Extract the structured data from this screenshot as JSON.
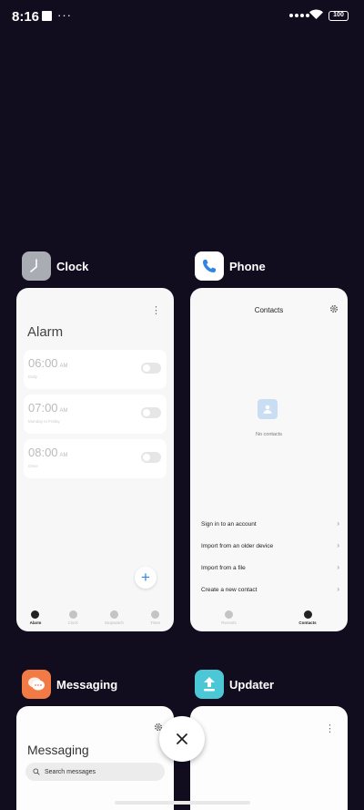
{
  "status": {
    "time": "8:16",
    "dots": "···",
    "battery": "100"
  },
  "apps": {
    "clock": {
      "name": "Clock",
      "title": "Alarm",
      "alarms": [
        {
          "time": "06:00",
          "ampm": "AM",
          "sub": "Daily"
        },
        {
          "time": "07:00",
          "ampm": "AM",
          "sub": "Monday to Friday"
        },
        {
          "time": "08:00",
          "ampm": "AM",
          "sub": "Once"
        }
      ],
      "tabs": [
        "Alarm",
        "Clock",
        "Stopwatch",
        "Timer"
      ],
      "fab": "+"
    },
    "phone": {
      "name": "Phone",
      "title": "Contacts",
      "empty": "No contacts",
      "items": [
        "Sign in to an account",
        "Import from an older device",
        "Import from a file",
        "Create a new contact"
      ],
      "tabs": [
        "Recents",
        "Contacts"
      ]
    },
    "messaging": {
      "name": "Messaging",
      "title": "Messaging",
      "search_placeholder": "Search messages"
    },
    "updater": {
      "name": "Updater"
    }
  },
  "colors": {
    "background": "#110d1f",
    "accent": "#2f86e8",
    "messaging_icon": "#f27a45",
    "updater_icon": "#4cc7d6"
  }
}
